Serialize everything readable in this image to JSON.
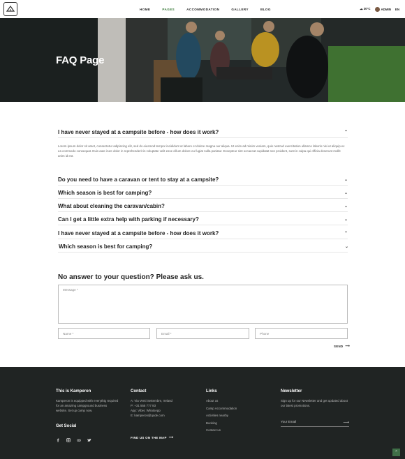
{
  "nav": {
    "items": [
      {
        "label": "HOME",
        "active": false
      },
      {
        "label": "PAGES",
        "active": true
      },
      {
        "label": "ACCOMMODATION",
        "active": false
      },
      {
        "label": "GALLERY",
        "active": false
      },
      {
        "label": "BLOG",
        "active": false
      }
    ]
  },
  "header": {
    "weather": "30°C",
    "user": "ADMIN",
    "lang": "EN"
  },
  "hero": {
    "title": "FAQ Page"
  },
  "faq": {
    "items": [
      {
        "question": "I have never stayed at a campsite before - how does it work?",
        "expanded": true
      },
      {
        "question": "Do you need to have a caravan or tent to stay at a campsite?",
        "expanded": false
      },
      {
        "question": "Which season is best for camping?",
        "expanded": false
      },
      {
        "question": "What about cleaning the caravan/cabin?",
        "expanded": false
      },
      {
        "question": "Can I get a little extra help with parking if necessary?",
        "expanded": false
      },
      {
        "question": "I have never stayed at a campsite before - how does it work?",
        "expanded": true
      },
      {
        "question": "Which season is best for camping?",
        "expanded": false
      }
    ],
    "answer": "Lorem ipsum dolor sit amet, consectetur adipiscing elit, sed do eiusmod tempor incididunt ut labore et dolore magna our aliqua. Ut enim ad minim veniam, quis nostrud exercitation ullamco laboris nisi ut aliquip ex ea commodo consequat. Duis aute irure dolor in reprehenderit in voluptate velit esse cillum dolore eu fugiat nulla pariatur. Excepteur sint occaecat cupidatat non proident, sunt in culpa qui officia deserunt mollit anim id est."
  },
  "contact_form": {
    "title": "No answer to your question? Please ask us.",
    "message_placeholder": "Message *",
    "name_placeholder": "Name *",
    "email_placeholder": "Email *",
    "phone_placeholder": "Phone",
    "send_label": "SEND"
  },
  "footer": {
    "about": {
      "title": "This is Kamperon",
      "text": "Kamperon is equipped with everythig required for an amazing campground business website. Set up camp now."
    },
    "social_title": "Get Social",
    "social_icons": [
      "facebook-icon",
      "instagram-icon",
      "tripadvisor-icon",
      "twitter-icon"
    ],
    "contact": {
      "title": "Contact",
      "lines": [
        "A: Via Venti Settembre, Ireland",
        "P: +31 555 777 83",
        "App: Viber, WhatsApp",
        "E: kamperon@qode.com"
      ],
      "map_link": "FIND US ON THE MAP"
    },
    "links": {
      "title": "Links",
      "items": [
        "About us",
        "Camp Accommodation",
        "Activities nearby",
        "Booking",
        "Contact us"
      ]
    },
    "newsletter": {
      "title": "Newsletter",
      "text": "Sign up for our Newsletter and get updated about our latest promotions.",
      "placeholder": "Your Email"
    }
  },
  "colors": {
    "accent": "#3a7a3a",
    "footer_bg": "#202423"
  }
}
